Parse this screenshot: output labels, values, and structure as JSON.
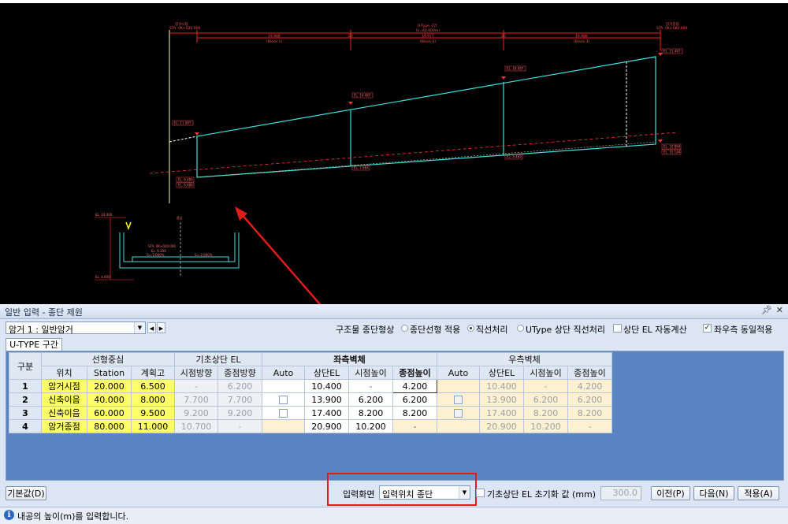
{
  "cad": {
    "top_labels": {
      "left_station": "STA. 0K+020.000",
      "right_station": "STA. 0K+080.000",
      "left_title": "암거시점",
      "right_title": "암거종점",
      "center_title": "U-Type 구간",
      "center_sub": "(L=60.000m)",
      "seg1": "19.988",
      "seg1_sub": "(Block-1)",
      "seg2": "19.977",
      "seg2_sub": "(Block-2)",
      "seg3": "19.988",
      "seg3_sub": "(Block-3)",
      "jt1": "20",
      "jt2": "20"
    },
    "el_labels": [
      "EL. 11.087",
      "EL. 14.487",
      "EL. 18.087",
      "EL. 21.487",
      "EL. 6.484",
      "EL. 6.684",
      "EL. 7.684",
      "EL. 9.484",
      "EL. 10.884",
      "EL. 10.184"
    ],
    "section_labels": [
      "EL. 10.400",
      "EL. 4.400",
      "STA. 0K+020.000",
      "EL. 6.200",
      "S=-2.000%",
      "S=-2.000%",
      "중심"
    ]
  },
  "panel": {
    "title": "일반 입력 - 종단 제원",
    "pin_icon": "pin-icon",
    "close_icon": "close-icon",
    "culvert_select": "암거 1 : 일반암거",
    "structure_label": "구조물 종단형상",
    "radio_options": [
      {
        "label": "종단선형 적용",
        "checked": false
      },
      {
        "label": "직선처리",
        "checked": true
      },
      {
        "label": "UType 상단 직선처리",
        "checked": false
      }
    ],
    "auto_el_label": "상단 EL 자동계산",
    "auto_el_checked": false,
    "same_apply_label": "좌우측 동일적용",
    "same_apply_checked": true,
    "tab_label": "U-TYPE 구간"
  },
  "table": {
    "group_headers": {
      "gubun": "구분",
      "line": "선형중심",
      "found": "기초상단 EL",
      "left": "좌측벽체",
      "right": "우측벽체"
    },
    "sub_headers": [
      "위치",
      "Station",
      "계획고",
      "시점방향",
      "종점방향",
      "Auto",
      "상단EL",
      "시점높이",
      "종점높이",
      "Auto",
      "상단EL",
      "시점높이",
      "종점높이"
    ],
    "rows": [
      {
        "no": "1",
        "pos": "암거시점",
        "station": "20.000",
        "plan": "6.500",
        "f_start": "-",
        "f_end": "6.200",
        "l_auto": false,
        "l_top": "10.400",
        "l_start": "-",
        "l_end": "4.200",
        "r_auto": false,
        "r_top": "10.400",
        "r_start": "-",
        "r_end": "4.200"
      },
      {
        "no": "2",
        "pos": "신축이음",
        "station": "40.000",
        "plan": "8.000",
        "f_start": "7.700",
        "f_end": "7.700",
        "l_auto": true,
        "l_top": "13.900",
        "l_start": "6.200",
        "l_end": "6.200",
        "r_auto": true,
        "r_top": "13.900",
        "r_start": "6.200",
        "r_end": "6.200"
      },
      {
        "no": "3",
        "pos": "신축이음",
        "station": "60.000",
        "plan": "9.500",
        "f_start": "9.200",
        "f_end": "9.200",
        "l_auto": true,
        "l_top": "17.400",
        "l_start": "8.200",
        "l_end": "8.200",
        "r_auto": true,
        "r_top": "17.400",
        "r_start": "8.200",
        "r_end": "8.200"
      },
      {
        "no": "4",
        "pos": "암거종점",
        "station": "80.000",
        "plan": "11.000",
        "f_start": "10.700",
        "f_end": "-",
        "l_auto": false,
        "l_top": "20.900",
        "l_start": "10.200",
        "l_end": "-",
        "r_auto": false,
        "r_top": "20.900",
        "r_start": "10.200",
        "r_end": "-"
      }
    ]
  },
  "footer": {
    "default_btn": "기본값(D)",
    "input_screen_label": "입력화면",
    "input_screen_value": "입력위치 종단",
    "init_label": "기초상단 EL 초기화 값 (mm)",
    "init_checked": false,
    "init_value": "300.0",
    "prev_btn": "이전(P)",
    "next_btn": "다음(N)",
    "apply_btn": "적용(A)"
  },
  "status": {
    "icon": "info-icon",
    "message": "내공의 높이(m)를 입력합니다."
  }
}
